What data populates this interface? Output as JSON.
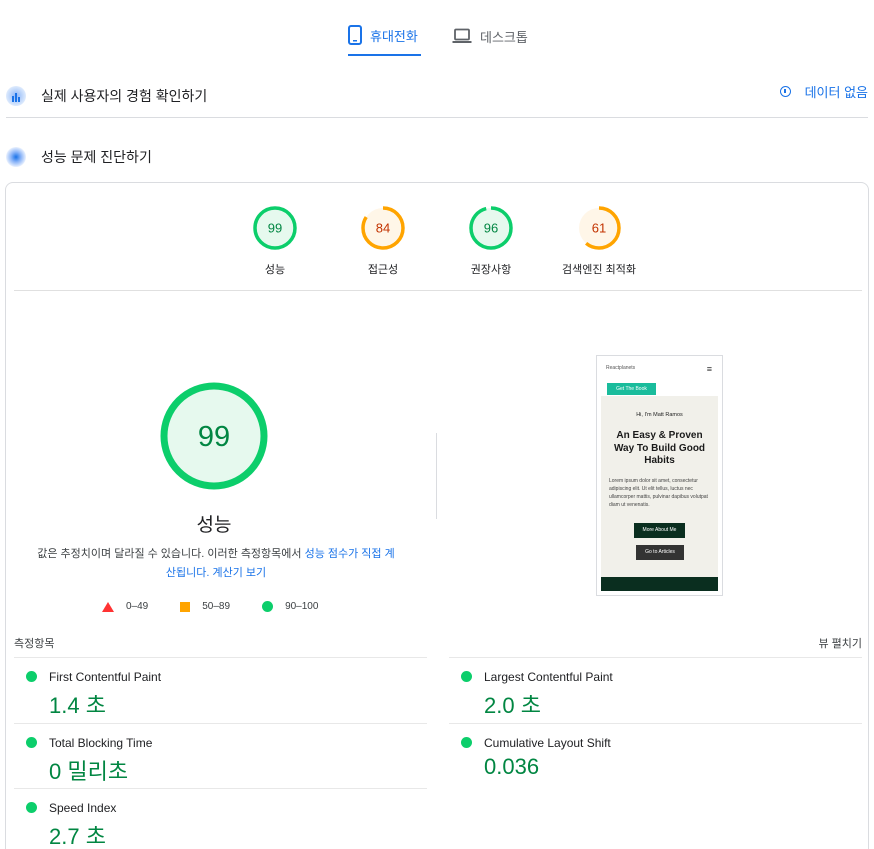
{
  "tabs": {
    "mobile": "휴대전화",
    "desktop": "데스크톱"
  },
  "field_section": {
    "title": "실제 사용자의 경험 확인하기",
    "no_data": "데이터 없음"
  },
  "lab_section": {
    "title": "성능 문제 진단하기"
  },
  "categories": [
    {
      "label": "성능",
      "score": "99",
      "color": "#0cce6b"
    },
    {
      "label": "접근성",
      "score": "84",
      "color": "#ffa400"
    },
    {
      "label": "권장사항",
      "score": "96",
      "color": "#0cce6b"
    },
    {
      "label": "검색엔진 최적화",
      "score": "61",
      "color": "#ffa400"
    }
  ],
  "performance": {
    "score": "99",
    "label": "성능",
    "desc_text": "값은 추정치이며 달라질 수 있습니다. 이러한 측정항목에서 ",
    "desc_link1": "성능 점수가 직접 계산됩니다.",
    "desc_link2": "계산기 보기"
  },
  "legend": {
    "fail": "0–49",
    "average": "50–89",
    "pass": "90–100"
  },
  "preview": {
    "logo_alt": "Reactplanets",
    "cta": "Get The Book",
    "hi": "Hi, I'm Matt Ramos",
    "headline": "An Easy & Proven Way To Build Good Habits",
    "lorem": "Lorem ipsum dolor sit amet, consectetur adipiscing elit. Ut elit tellus, luctus nec ullamcorper mattis, pulvinar dapibus volutpat diam ut venenatis.",
    "btn_primary": "More About Me",
    "btn_secondary": "Go to Articles"
  },
  "metrics_header": {
    "title": "측정항목",
    "expand": "뷰 펼치기"
  },
  "metrics": [
    {
      "name": "First Contentful Paint",
      "value": "1.4 초"
    },
    {
      "name": "Largest Contentful Paint",
      "value": "2.0 초"
    },
    {
      "name": "Total Blocking Time",
      "value": "0 밀리초"
    },
    {
      "name": "Cumulative Layout Shift",
      "value": "0.036"
    },
    {
      "name": "Speed Index",
      "value": "2.7 초"
    }
  ]
}
